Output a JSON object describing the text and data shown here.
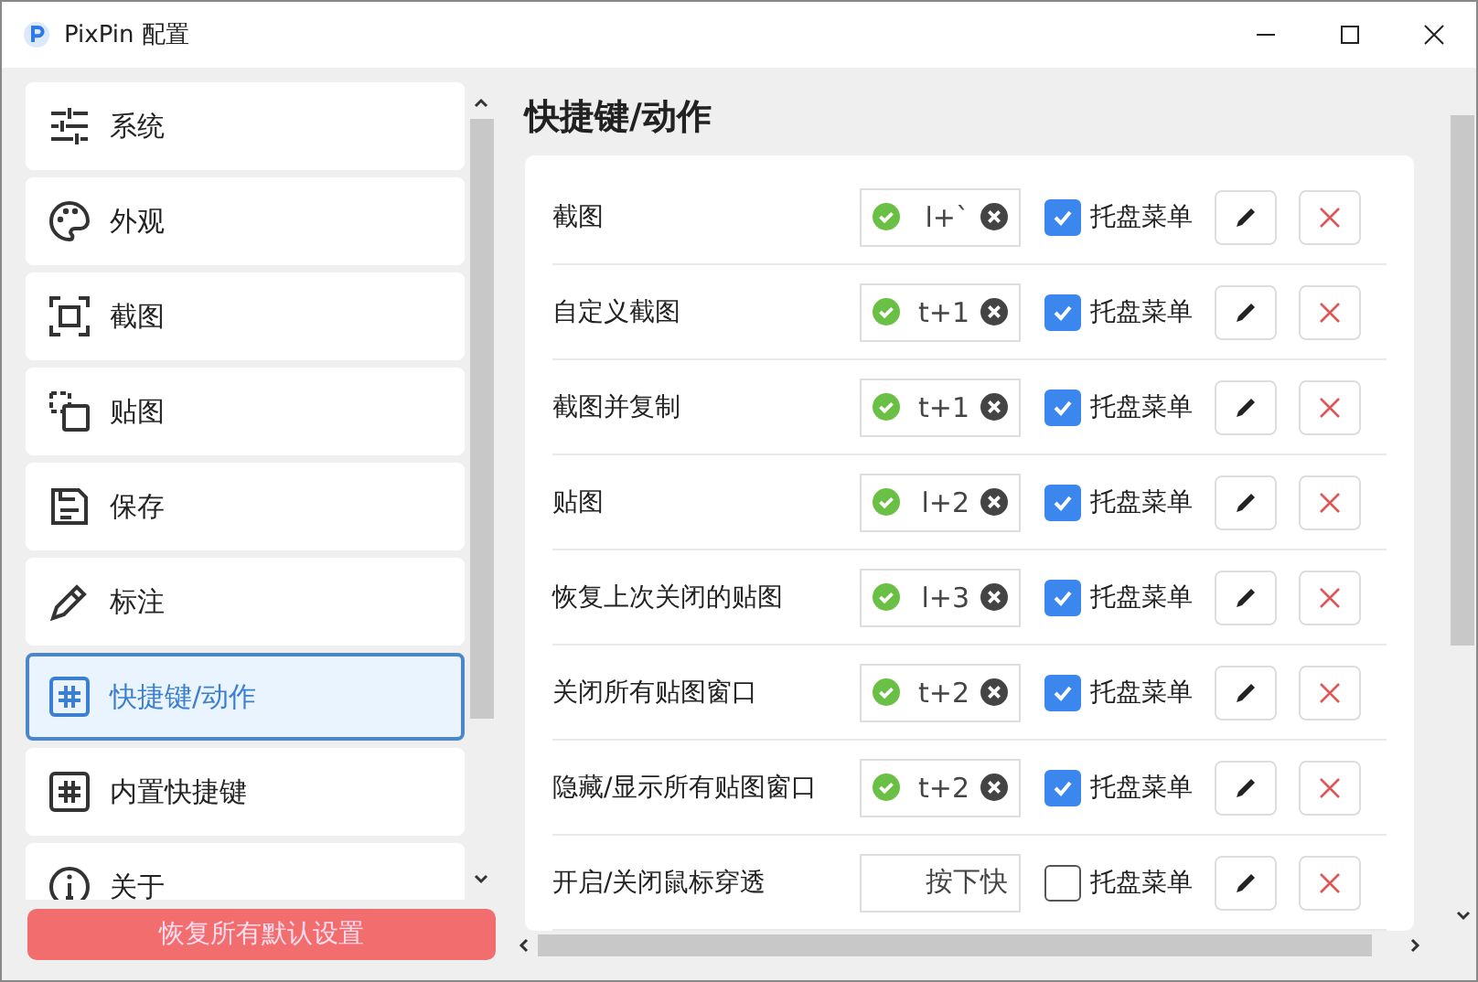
{
  "window": {
    "title": "PixPin 配置"
  },
  "sidebar": {
    "items": [
      {
        "label": "系统",
        "selected": false
      },
      {
        "label": "外观",
        "selected": false
      },
      {
        "label": "截图",
        "selected": false
      },
      {
        "label": "贴图",
        "selected": false
      },
      {
        "label": "保存",
        "selected": false
      },
      {
        "label": "标注",
        "selected": false
      },
      {
        "label": "快捷键/动作",
        "selected": true
      },
      {
        "label": "内置快捷键",
        "selected": false
      },
      {
        "label": "关于",
        "selected": false
      }
    ],
    "reset_button": "恢复所有默认设置"
  },
  "main": {
    "heading": "快捷键/动作",
    "rows": [
      {
        "action": "截图",
        "hotkey": "l+`",
        "valid": true,
        "tray_label": "托盘菜单",
        "tray_checked": true
      },
      {
        "action": "自定义截图",
        "hotkey": "t+1",
        "valid": true,
        "tray_label": "托盘菜单",
        "tray_checked": true
      },
      {
        "action": "截图并复制",
        "hotkey": "t+1",
        "valid": true,
        "tray_label": "托盘菜单",
        "tray_checked": true
      },
      {
        "action": "贴图",
        "hotkey": "l+2",
        "valid": true,
        "tray_label": "托盘菜单",
        "tray_checked": true
      },
      {
        "action": "恢复上次关闭的贴图",
        "hotkey": "l+3",
        "valid": true,
        "tray_label": "托盘菜单",
        "tray_checked": true
      },
      {
        "action": "关闭所有贴图窗口",
        "hotkey": "t+2",
        "valid": true,
        "tray_label": "托盘菜单",
        "tray_checked": true
      },
      {
        "action": "隐藏/显示所有贴图窗口",
        "hotkey": "t+2",
        "valid": true,
        "tray_label": "托盘菜单",
        "tray_checked": true
      },
      {
        "action": "开启/关闭鼠标穿透",
        "hotkey": "按下快",
        "valid": false,
        "tray_label": "托盘菜单",
        "tray_checked": false
      }
    ]
  }
}
